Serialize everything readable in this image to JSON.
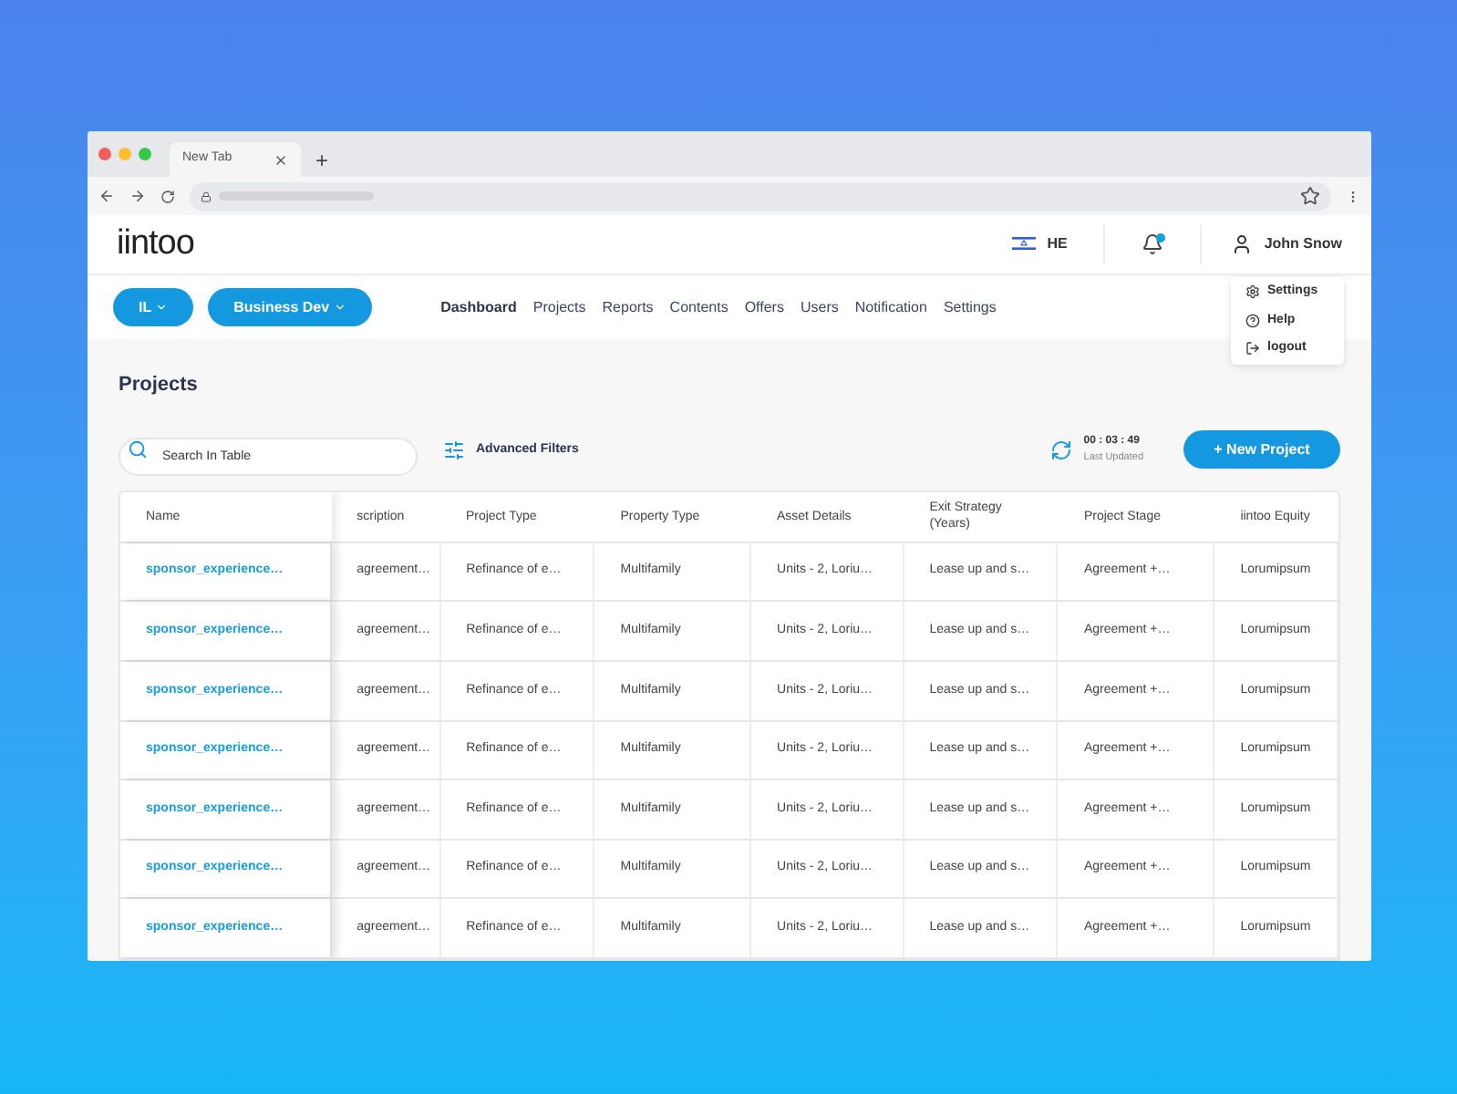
{
  "browser": {
    "tab_title": "New Tab",
    "new_tab": "+"
  },
  "header": {
    "logo": "iintoo",
    "language": "HE",
    "user": "John Snow",
    "notification_unread": true
  },
  "user_menu": [
    {
      "label": "Settings",
      "kind": "gear"
    },
    {
      "label": "Help",
      "kind": "help"
    },
    {
      "label": "logout",
      "kind": "logout"
    }
  ],
  "selectors": [
    {
      "label": "IL"
    },
    {
      "label": "Business Dev"
    }
  ],
  "nav": [
    {
      "label": "Dashboard",
      "selected": true
    },
    {
      "label": "Projects",
      "selected": false
    },
    {
      "label": "Reports",
      "selected": false
    },
    {
      "label": "Contents",
      "selected": false
    },
    {
      "label": "Offers",
      "selected": false
    },
    {
      "label": "Users",
      "selected": false
    },
    {
      "label": "Notification",
      "selected": false
    },
    {
      "label": "Settings",
      "selected": false
    }
  ],
  "page_title": "Projects",
  "search": {
    "placeholder": "Search In Table"
  },
  "advanced_filters": "Advanced Filters",
  "timer": {
    "time": "00 : 03 : 49",
    "label": "Last Updated"
  },
  "new_project": "+ New Project",
  "table": {
    "columns": [
      "Name",
      "scription",
      "Project Type",
      "Property Type",
      "Asset Details",
      "Exit Strategy (Years)",
      "Project Stage",
      "iintoo Equity"
    ],
    "rows": [
      [
        "sponsor_experience…",
        "agreement…",
        "Refinance of e…",
        "Multifamily",
        "Units - 2, Loriu…",
        "Lease up and s…",
        "Agreement +…",
        "Lorumipsum"
      ],
      [
        "sponsor_experience…",
        "agreement…",
        "Refinance of e…",
        "Multifamily",
        "Units - 2, Loriu…",
        "Lease up and s…",
        "Agreement +…",
        "Lorumipsum"
      ],
      [
        "sponsor_experience…",
        "agreement…",
        "Refinance of e…",
        "Multifamily",
        "Units - 2, Loriu…",
        "Lease up and s…",
        "Agreement +…",
        "Lorumipsum"
      ],
      [
        "sponsor_experience…",
        "agreement…",
        "Refinance of e…",
        "Multifamily",
        "Units - 2, Loriu…",
        "Lease up and s…",
        "Agreement +…",
        "Lorumipsum"
      ],
      [
        "sponsor_experience…",
        "agreement…",
        "Refinance of e…",
        "Multifamily",
        "Units - 2, Loriu…",
        "Lease up and s…",
        "Agreement +…",
        "Lorumipsum"
      ],
      [
        "sponsor_experience…",
        "agreement…",
        "Refinance of e…",
        "Multifamily",
        "Units - 2, Loriu…",
        "Lease up and s…",
        "Agreement +…",
        "Lorumipsum"
      ],
      [
        "sponsor_experience…",
        "agreement…",
        "Refinance of e…",
        "Multifamily",
        "Units - 2, Loriu…",
        "Lease up and s…",
        "Agreement +…",
        "Lorumipsum"
      ]
    ]
  }
}
